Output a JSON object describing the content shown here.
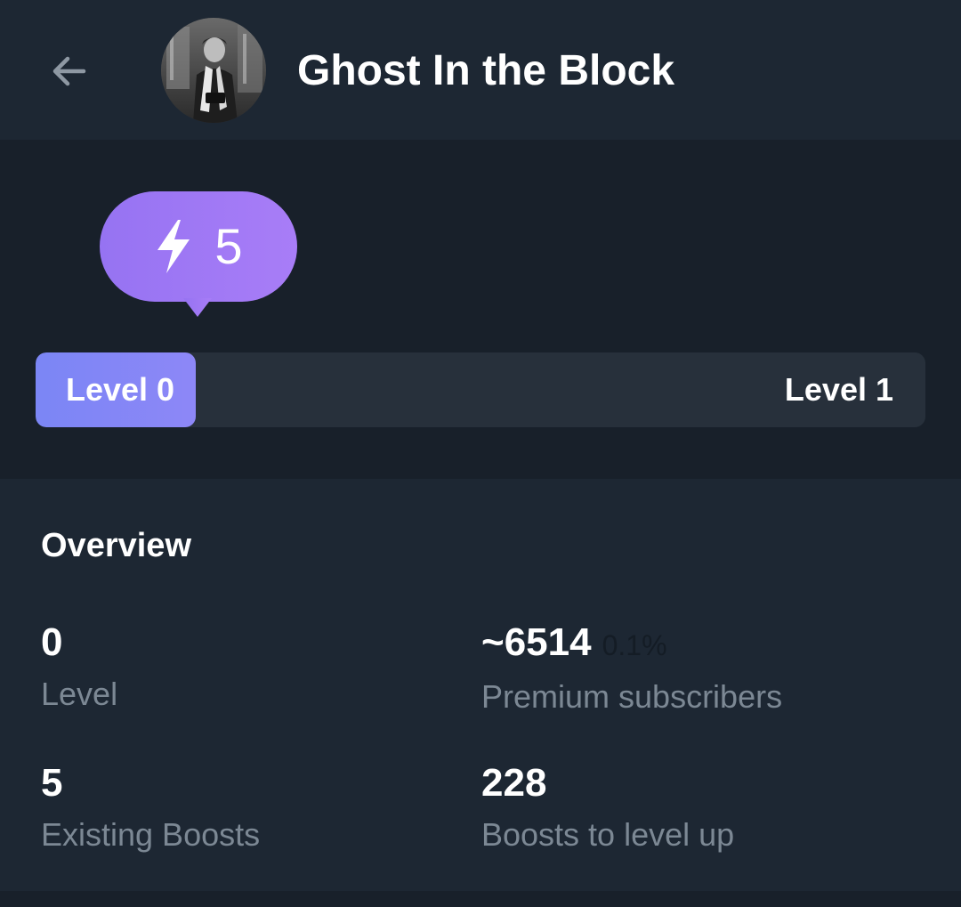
{
  "header": {
    "back_icon": "arrow-left-icon",
    "channel_name": "Ghost In the Block"
  },
  "boost": {
    "icon": "lightning-bolt-icon",
    "count": "5",
    "bubble_color": "#9b7cf7",
    "progress": {
      "start_label": "Level 0",
      "end_label": "Level 1",
      "fill_fraction": 0.18,
      "fill_color": "#7b86f5"
    }
  },
  "overview": {
    "title": "Overview",
    "stats": [
      {
        "value": "0",
        "label": "Level"
      },
      {
        "value": "~6514",
        "percent": "0.1%",
        "label": "Premium subscribers"
      },
      {
        "value": "5",
        "label": "Existing Boosts"
      },
      {
        "value": "228",
        "label": "Boosts to level up"
      }
    ]
  },
  "colors": {
    "background": "#1d2733",
    "section_background": "#18202a",
    "secondary_text": "#7c8894"
  }
}
